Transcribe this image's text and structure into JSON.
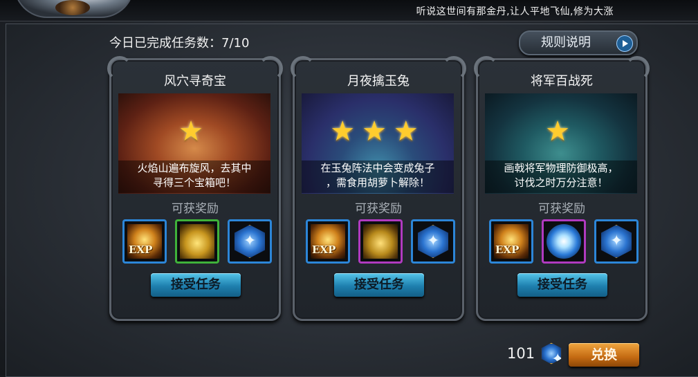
{
  "top": {
    "marquee": "听说这世间有那金丹,让人平地飞仙,修为大涨"
  },
  "header": {
    "completed_label": "今日已完成任务数：7/10",
    "rules_label": "规则说明"
  },
  "reward_label": "可获奖励",
  "accept_label": "接受任务",
  "cards": [
    {
      "title": "风穴寻奇宝",
      "stars": "★",
      "desc_line1": "火焰山遍布旋风，去其中",
      "desc_line2": "寻得三个宝箱吧！",
      "rewards": [
        {
          "icon": "exp-icon",
          "label": "EXP",
          "border": "blue"
        },
        {
          "icon": "gold-coins-icon",
          "border": "green"
        },
        {
          "icon": "blue-crystal-icon",
          "border": "blue"
        }
      ]
    },
    {
      "title": "月夜擒玉兔",
      "stars": "★★★",
      "desc_line1": "在玉兔阵法中会变成兔子",
      "desc_line2": "，需食用胡萝卜解除！",
      "rewards": [
        {
          "icon": "exp-icon",
          "label": "EXP",
          "border": "blue"
        },
        {
          "icon": "gold-bag-icon",
          "border": "purple"
        },
        {
          "icon": "blue-crystal-icon",
          "border": "blue"
        }
      ]
    },
    {
      "title": "将军百战死",
      "stars": "★",
      "desc_line1": "画戟将军物理防御极高，",
      "desc_line2": "讨伐之时万分注意！",
      "rewards": [
        {
          "icon": "exp-icon",
          "label": "EXP",
          "border": "blue"
        },
        {
          "icon": "spirit-orb-icon",
          "border": "purple"
        },
        {
          "icon": "blue-crystal-icon",
          "border": "blue"
        }
      ]
    }
  ],
  "footer": {
    "amount": "101",
    "exchange_label": "兑换"
  },
  "colors": {
    "accept_button": "#2a96c6",
    "exchange_button": "#d9801f",
    "star": "#ffcc2e"
  }
}
